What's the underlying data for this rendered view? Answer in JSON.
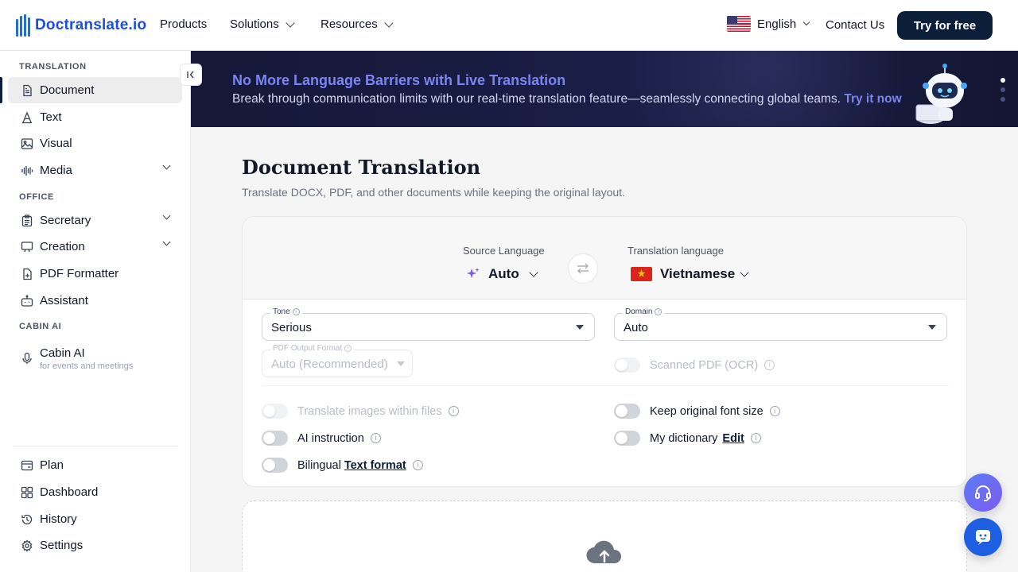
{
  "header": {
    "logo_text": "Doctranslate.io",
    "nav": [
      {
        "label": "Products",
        "has_menu": false
      },
      {
        "label": "Solutions",
        "has_menu": true
      },
      {
        "label": "Resources",
        "has_menu": true
      }
    ],
    "language": "English",
    "contact": "Contact Us",
    "cta": "Try for free"
  },
  "sidebar": {
    "sections": {
      "translation": "TRANSLATION",
      "office": "OFFICE",
      "cabin": "CABIN AI"
    },
    "items": {
      "document": "Document",
      "text": "Text",
      "visual": "Visual",
      "media": "Media",
      "secretary": "Secretary",
      "creation": "Creation",
      "pdf_formatter": "PDF Formatter",
      "assistant": "Assistant",
      "cabin_ai": "Cabin AI",
      "cabin_ai_sub": "for events and meetings",
      "plan": "Plan",
      "dashboard": "Dashboard",
      "history": "History",
      "settings": "Settings"
    }
  },
  "banner": {
    "title": "No More Language Barriers with Live Translation",
    "subtitle": "Break through communication limits with our real-time translation feature—seamlessly connecting global teams.",
    "link": "Try it now"
  },
  "main": {
    "title": "Document Translation",
    "subtitle": "Translate DOCX, PDF, and other documents while keeping the original layout.",
    "source_label": "Source Language",
    "source_value": "Auto",
    "target_label": "Translation language",
    "target_value": "Vietnamese",
    "tone": {
      "label": "Tone",
      "value": "Serious"
    },
    "domain": {
      "label": "Domain",
      "value": "Auto"
    },
    "pdf_output": {
      "label": "PDF Output Format",
      "value": "Auto (Recommended)"
    },
    "scanned_pdf": "Scanned PDF (OCR)",
    "toggles": {
      "translate_images": "Translate images within files",
      "keep_font": "Keep original font size",
      "ai_instruction": "AI instruction",
      "my_dictionary": "My dictionary",
      "edit": "Edit",
      "bilingual": "Bilingual",
      "text_format": "Text format"
    }
  },
  "colors": {
    "brand": "#1d4ed8",
    "cta_bg": "#0b1f3a",
    "banner_accent": "#7c83f2"
  }
}
